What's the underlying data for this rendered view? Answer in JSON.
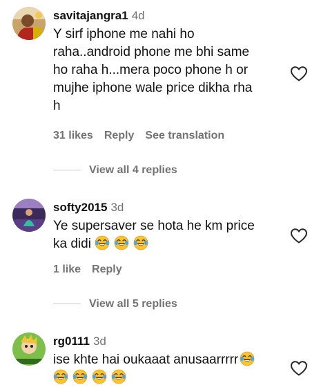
{
  "comments": [
    {
      "username": "savitajangra1",
      "age": "4d",
      "lines": [
        "Y sirf iphone me nahi ho",
        "raha..android phone me bhi same",
        "ho raha h...mera poco phone h or",
        "mujhe iphone wale price dikha rha",
        "h"
      ],
      "likes": "31 likes",
      "reply": "Reply",
      "translation": "See translation",
      "view_replies": "View all 4 replies"
    },
    {
      "username": "softy2015",
      "age": "3d",
      "lines": [
        "Ye supersaver se hota he km price",
        "ka didi"
      ],
      "likes": "1 like",
      "reply": "Reply",
      "view_replies": "View all 5 replies"
    },
    {
      "username": "rg0111",
      "age": "3d",
      "lines": [
        "ise khte hai oukaaat anusaarrrrr"
      ]
    }
  ],
  "icons": {
    "like": "heart-outline-icon",
    "laugh": "face-with-tears-of-joy-emoji"
  }
}
